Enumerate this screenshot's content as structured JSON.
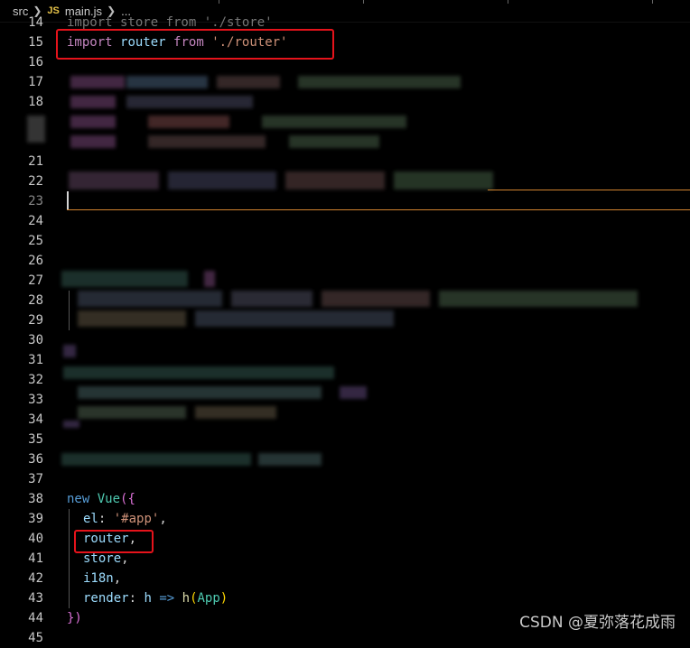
{
  "breadcrumb": {
    "folder": "src",
    "file_badge": "JS",
    "file": "main.js",
    "trailing": "..."
  },
  "editor": {
    "lines": {
      "l14": {
        "num": "14",
        "text": "import store from './store'"
      },
      "l15": {
        "num": "15",
        "kw": "import",
        "id": "router",
        "from": "from",
        "str": "'./router'"
      },
      "l16": {
        "num": "16"
      },
      "l17": {
        "num": "17"
      },
      "l18": {
        "num": "18"
      },
      "l21": {
        "num": "21"
      },
      "l22": {
        "num": "22"
      },
      "l23": {
        "num": "23"
      },
      "l24": {
        "num": "24"
      },
      "l25": {
        "num": "25"
      },
      "l26": {
        "num": "26"
      },
      "l27": {
        "num": "27"
      },
      "l28": {
        "num": "28"
      },
      "l29": {
        "num": "29"
      },
      "l30": {
        "num": "30"
      },
      "l31": {
        "num": "31"
      },
      "l32": {
        "num": "32"
      },
      "l33": {
        "num": "33"
      },
      "l34": {
        "num": "34"
      },
      "l35": {
        "num": "35"
      },
      "l36": {
        "num": "36"
      },
      "l37": {
        "num": "37"
      },
      "l38": {
        "num": "38",
        "kw": "new",
        "cls": "Vue",
        "open": "({"
      },
      "l39": {
        "num": "39",
        "key": "el",
        "colon": ":",
        "str": "'#app'",
        "comma": ","
      },
      "l40": {
        "num": "40",
        "id": "router",
        "comma": ","
      },
      "l41": {
        "num": "41",
        "id": "store",
        "comma": ","
      },
      "l42": {
        "num": "42",
        "id": "i18n",
        "comma": ","
      },
      "l43": {
        "num": "43",
        "key": "render",
        "colon": ":",
        "param": "h",
        "arrow": "=>",
        "fn": "h",
        "arg": "App"
      },
      "l44": {
        "num": "44",
        "close": "})"
      },
      "l45": {
        "num": "45"
      }
    }
  },
  "watermark": "CSDN @夏弥落花成雨",
  "colors": {
    "background": "#000000",
    "highlight_box": "#e5131b",
    "keyword": "#c586c0",
    "identifier": "#9cdcfe",
    "string": "#ce9178",
    "class": "#4ec9b0"
  }
}
